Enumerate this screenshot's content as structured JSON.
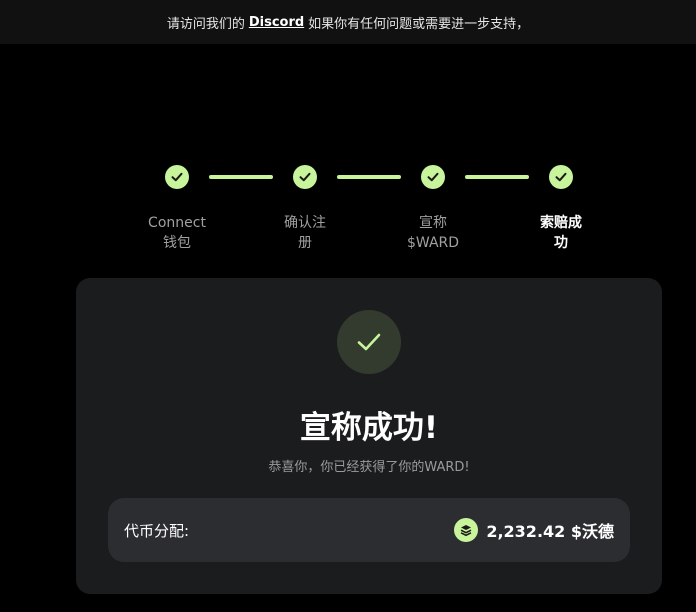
{
  "banner": {
    "prefix": "请访问我们的",
    "link": "Discord",
    "suffix": "如果你有任何问题或需要进一步支持，"
  },
  "steps": [
    {
      "line1": "Connect",
      "line2": "钱包",
      "state": "complete",
      "current": false
    },
    {
      "line1": "确认注",
      "line2": "册",
      "state": "complete",
      "current": false
    },
    {
      "line1": "宣称",
      "line2": "$WARD",
      "state": "complete",
      "current": false
    },
    {
      "line1": "索赔成",
      "line2": "功",
      "state": "complete",
      "current": true
    }
  ],
  "card": {
    "title": "宣称成功!",
    "subtitle": "恭喜你，你已经获得了你的WARD!",
    "allocation": {
      "label": "代币分配:",
      "amount": "2,232.42 $沃德"
    }
  },
  "colors": {
    "accent": "#c8f59b",
    "background": "#000000",
    "card": "#1b1c1e",
    "alloc_box": "#2c2d31"
  },
  "icons": [
    "check-icon",
    "ward-token-icon"
  ]
}
